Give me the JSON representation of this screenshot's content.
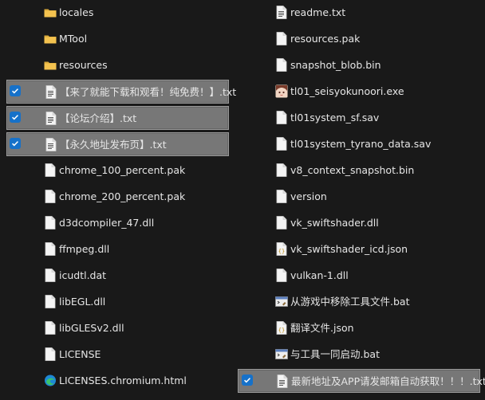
{
  "left_column": [
    {
      "name": "locales",
      "icon": "folder-icon",
      "selected": false
    },
    {
      "name": "MTool",
      "icon": "folder-icon",
      "selected": false
    },
    {
      "name": "resources",
      "icon": "folder-icon",
      "selected": false
    },
    {
      "name": "【来了就能下载和观看！纯免费！】.txt",
      "icon": "text-file-icon",
      "selected": true
    },
    {
      "name": "【论坛介绍】.txt",
      "icon": "text-file-icon",
      "selected": true
    },
    {
      "name": "【永久地址发布页】.txt",
      "icon": "text-file-icon",
      "selected": true
    },
    {
      "name": "chrome_100_percent.pak",
      "icon": "file-icon",
      "selected": false
    },
    {
      "name": "chrome_200_percent.pak",
      "icon": "file-icon",
      "selected": false
    },
    {
      "name": "d3dcompiler_47.dll",
      "icon": "file-icon",
      "selected": false
    },
    {
      "name": "ffmpeg.dll",
      "icon": "file-icon",
      "selected": false
    },
    {
      "name": "icudtl.dat",
      "icon": "file-icon",
      "selected": false
    },
    {
      "name": "libEGL.dll",
      "icon": "file-icon",
      "selected": false
    },
    {
      "name": "libGLESv2.dll",
      "icon": "file-icon",
      "selected": false
    },
    {
      "name": "LICENSE",
      "icon": "file-icon",
      "selected": false
    },
    {
      "name": "LICENSES.chromium.html",
      "icon": "edge-html-icon",
      "selected": false
    }
  ],
  "right_column": [
    {
      "name": "readme.txt",
      "icon": "text-file-icon",
      "selected": false
    },
    {
      "name": "resources.pak",
      "icon": "file-icon",
      "selected": false
    },
    {
      "name": "snapshot_blob.bin",
      "icon": "file-icon",
      "selected": false
    },
    {
      "name": "tl01_seisyokunoori.exe",
      "icon": "app-exe-icon",
      "selected": false
    },
    {
      "name": "tl01system_sf.sav",
      "icon": "file-icon",
      "selected": false
    },
    {
      "name": "tl01system_tyrano_data.sav",
      "icon": "file-icon",
      "selected": false
    },
    {
      "name": "v8_context_snapshot.bin",
      "icon": "file-icon",
      "selected": false
    },
    {
      "name": "version",
      "icon": "file-icon",
      "selected": false
    },
    {
      "name": "vk_swiftshader.dll",
      "icon": "file-icon",
      "selected": false
    },
    {
      "name": "vk_swiftshader_icd.json",
      "icon": "json-file-icon",
      "selected": false
    },
    {
      "name": "vulkan-1.dll",
      "icon": "file-icon",
      "selected": false
    },
    {
      "name": "从游戏中移除工具文件.bat",
      "icon": "batch-file-icon",
      "selected": false
    },
    {
      "name": "翻译文件.json",
      "icon": "json-file-icon",
      "selected": false
    },
    {
      "name": "与工具一同启动.bat",
      "icon": "batch-file-icon",
      "selected": false
    },
    {
      "name": "最新地址及APP请发邮箱自动获取！！！.txt",
      "icon": "text-file-icon",
      "selected": true
    }
  ],
  "colors": {
    "background": "#191919",
    "text": "#e6e6e6",
    "selection": "#777777",
    "checkbox": "#1671c9",
    "folder": "#f3c24f"
  }
}
